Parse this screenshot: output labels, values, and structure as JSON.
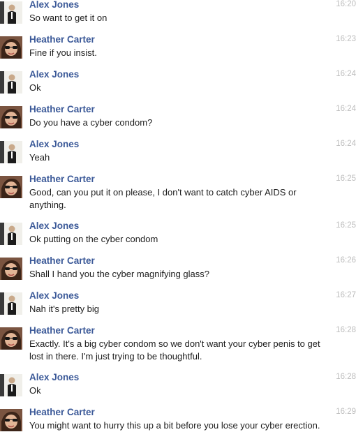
{
  "messages": [
    {
      "sender": "Alex Jones",
      "time": "16:20",
      "text": "So want to get it on",
      "avatar": "avatar-alex-icon"
    },
    {
      "sender": "Heather Carter",
      "time": "16:23",
      "text": "Fine if you insist.",
      "avatar": "avatar-heather-icon"
    },
    {
      "sender": "Alex Jones",
      "time": "16:24",
      "text": "Ok",
      "avatar": "avatar-alex-icon"
    },
    {
      "sender": "Heather Carter",
      "time": "16:24",
      "text": "Do you have a cyber condom?",
      "avatar": "avatar-heather-icon"
    },
    {
      "sender": "Alex Jones",
      "time": "16:24",
      "text": "Yeah",
      "avatar": "avatar-alex-icon"
    },
    {
      "sender": "Heather Carter",
      "time": "16:25",
      "text": "Good, can you put it on please, I don't want to catch cyber AIDS or anything.",
      "avatar": "avatar-heather-icon"
    },
    {
      "sender": "Alex Jones",
      "time": "16:25",
      "text": "Ok putting on the cyber condom",
      "avatar": "avatar-alex-icon"
    },
    {
      "sender": "Heather Carter",
      "time": "16:26",
      "text": "Shall I hand you the cyber magnifying glass?",
      "avatar": "avatar-heather-icon"
    },
    {
      "sender": "Alex Jones",
      "time": "16:27",
      "text": "Nah it's pretty big",
      "avatar": "avatar-alex-icon"
    },
    {
      "sender": "Heather Carter",
      "time": "16:28",
      "text": "Exactly. It's a big cyber condom so we don't want your cyber penis to get lost in there. I'm just trying to be thoughtful.",
      "avatar": "avatar-heather-icon"
    },
    {
      "sender": "Alex Jones",
      "time": "16:28",
      "text": "Ok",
      "avatar": "avatar-alex-icon"
    },
    {
      "sender": "Heather Carter",
      "time": "16:29",
      "text": "You might want to hurry this up a bit before you lose your cyber erection.",
      "avatar": "avatar-heather-icon"
    }
  ],
  "colors": {
    "sender_name": "#3b5998",
    "message_text": "#1d1d1d",
    "timestamp": "#bdbdbd"
  }
}
